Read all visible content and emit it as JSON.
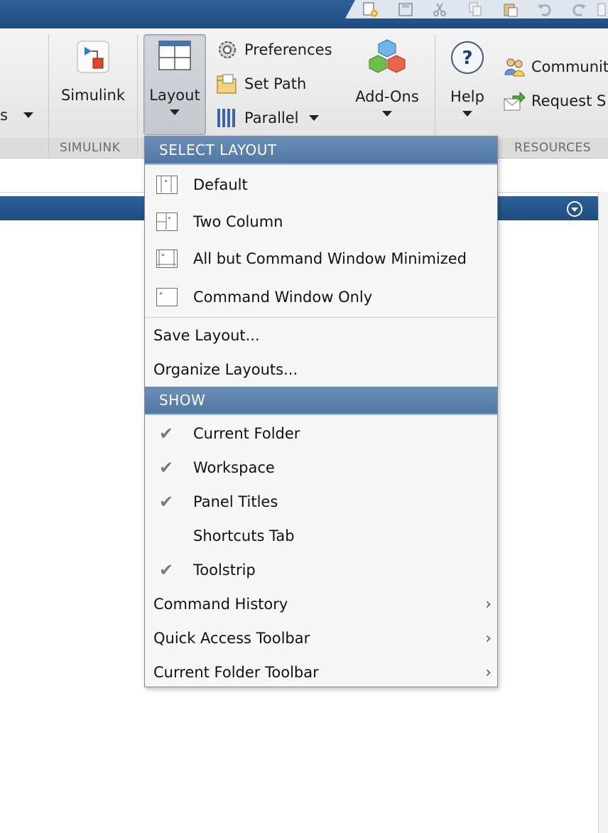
{
  "toolstrip": {
    "partial_left_label": "s",
    "simulink": {
      "label": "Simulink",
      "section": "SIMULINK"
    },
    "layout": {
      "label": "Layout"
    },
    "preferences": {
      "label": "Preferences"
    },
    "set_path": {
      "label": "Set Path"
    },
    "parallel": {
      "label": "Parallel"
    },
    "addons": {
      "label": "Add-Ons"
    },
    "help": {
      "label": "Help"
    },
    "community": {
      "label": "Communit"
    },
    "request_support": {
      "label": "Request S"
    },
    "resources_section": "RESOURCES"
  },
  "quick_access": [
    "new-icon",
    "save-icon",
    "cut-icon",
    "copy-icon",
    "paste-icon",
    "undo-icon",
    "redo-icon",
    "switch-icon"
  ],
  "menu": {
    "select_layout_header": "SELECT LAYOUT",
    "layouts": [
      {
        "label": "Default"
      },
      {
        "label": "Two Column"
      },
      {
        "label": "All but Command Window Minimized"
      },
      {
        "label": "Command Window Only"
      }
    ],
    "save_layout": "Save Layout...",
    "organize_layouts": "Organize Layouts...",
    "show_header": "SHOW",
    "show_items": [
      {
        "label": "Current Folder",
        "checked": true
      },
      {
        "label": "Workspace",
        "checked": true
      },
      {
        "label": "Panel Titles",
        "checked": true
      },
      {
        "label": "Shortcuts Tab",
        "checked": false
      },
      {
        "label": "Toolstrip",
        "checked": true
      }
    ],
    "submenus": [
      {
        "label": "Command History"
      },
      {
        "label": "Quick Access Toolbar"
      },
      {
        "label": "Current Folder Toolbar"
      }
    ]
  },
  "colors": {
    "title_blue": "#1f4d80",
    "menu_header": "#5a80ab",
    "check_gray": "#7a7a7a"
  }
}
